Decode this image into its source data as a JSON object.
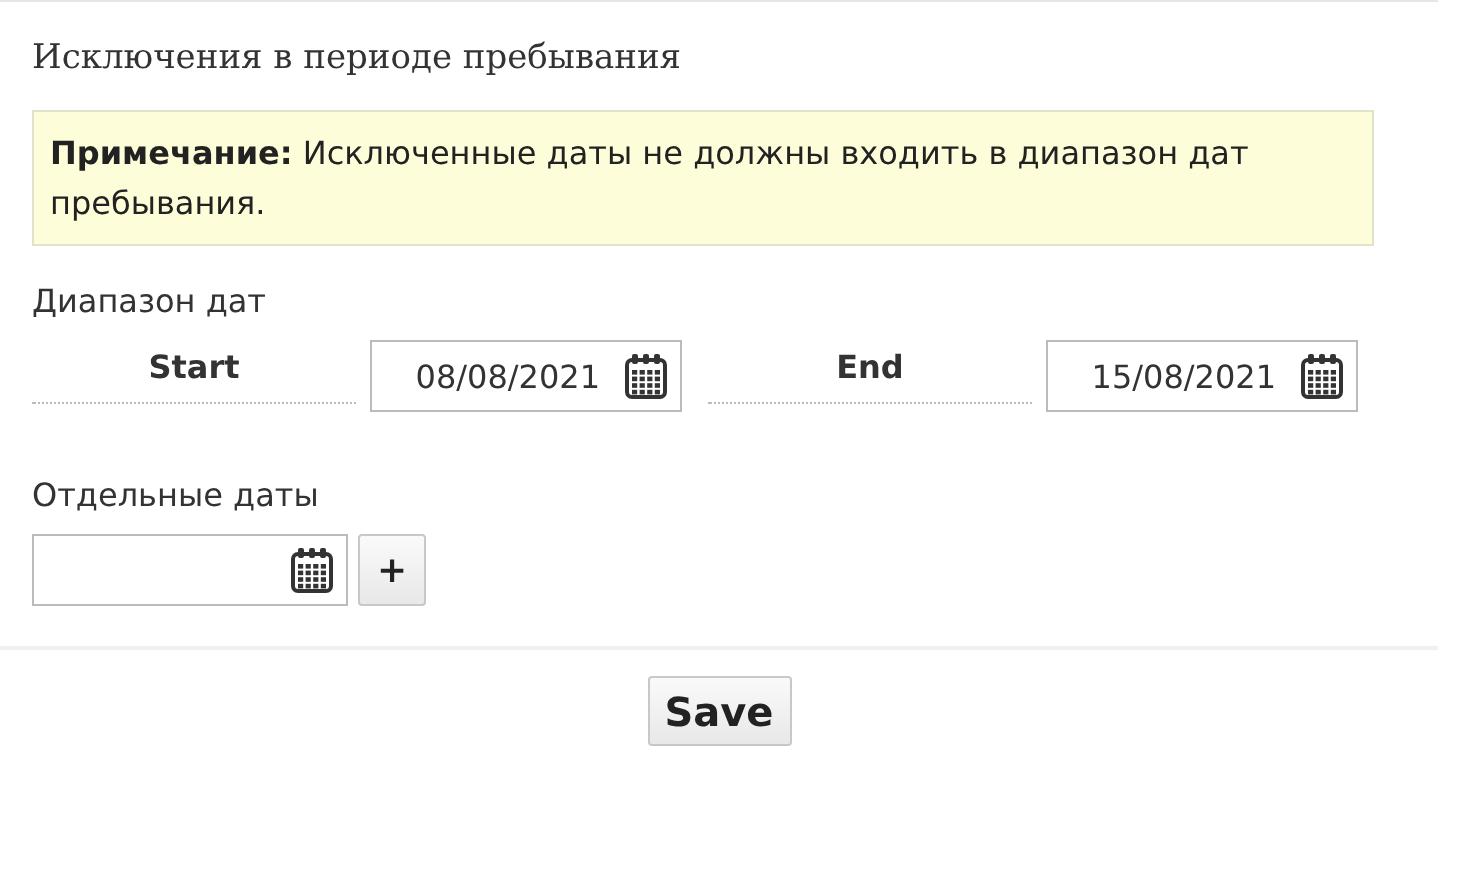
{
  "title": "Исключения в периоде пребывания",
  "note": "**Примечание:** Исключенные даты не должны входить в диапазон дат пребывания.",
  "date_range": {
    "label": "Диапазон дат",
    "fields": [
      {
        "label": "Start",
        "value": "08/08/2021"
      },
      {
        "label": "End",
        "value": "15/08/2021"
      }
    ]
  },
  "single_dates": {
    "label": "Отдельные даты",
    "add_button": "+"
  },
  "save_button": "Save"
}
